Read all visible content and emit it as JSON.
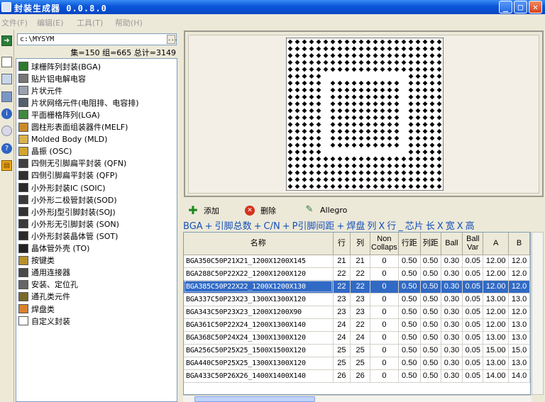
{
  "app": {
    "title": "封装生成器 0.0.8.0"
  },
  "window_buttons": {
    "minimize": "_",
    "maximize": "□",
    "close": "✕"
  },
  "menu": [
    {
      "label": "文件(F)"
    },
    {
      "label": "编辑(E)"
    },
    {
      "label": "工具(T)"
    },
    {
      "label": "帮助(H)"
    }
  ],
  "path": {
    "value": "c:\\MYSYM",
    "browse_label": "..."
  },
  "stats": "集=150 组=665 总计=3149",
  "tree": [
    {
      "label": "球栅阵列封装(BGA)",
      "icon": "bga-icon",
      "color": "#2f7a2f"
    },
    {
      "label": "贴片铝电解电容",
      "icon": "capacitor-icon",
      "color": "#777777"
    },
    {
      "label": "片状元件",
      "icon": "chip-component-icon",
      "color": "#9aa2b0"
    },
    {
      "label": "片状网络元件(电阻排、电容排)",
      "icon": "chip-network-icon",
      "color": "#55606e"
    },
    {
      "label": "平面栅格阵列(LGA)",
      "icon": "lga-icon",
      "color": "#3d8a3d"
    },
    {
      "label": "圆柱形表面组装器件(MELF)",
      "icon": "melf-icon",
      "color": "#c98a2a"
    },
    {
      "label": "Molded Body (MLD)",
      "icon": "molded-body-icon",
      "color": "#d9b24a"
    },
    {
      "label": "晶振 (OSC)",
      "icon": "oscillator-icon",
      "color": "#d2a52e"
    },
    {
      "label": "四侧无引脚扁平封装 (QFN)",
      "icon": "qfn-icon",
      "color": "#404040"
    },
    {
      "label": "四侧引脚扁平封装 (QFP)",
      "icon": "qfp-icon",
      "color": "#303030"
    },
    {
      "label": "小外形封装IC (SOIC)",
      "icon": "soic-icon",
      "color": "#2a2a2a"
    },
    {
      "label": "小外形二极管封装(SOD)",
      "icon": "sod-icon",
      "color": "#3a3a3a"
    },
    {
      "label": "小外形J型引脚封装(SOJ)",
      "icon": "soj-icon",
      "color": "#333333"
    },
    {
      "label": "小外形无引脚封装 (SON)",
      "icon": "son-icon",
      "color": "#3a3a3a"
    },
    {
      "label": "小外形封装晶体管 (SOT)",
      "icon": "sot-icon",
      "color": "#2b2b2b"
    },
    {
      "label": "晶体管外壳 (TO)",
      "icon": "to-icon",
      "color": "#222222"
    },
    {
      "label": "按键类",
      "icon": "button-icon",
      "color": "#b8902a"
    },
    {
      "label": "通用连接器",
      "icon": "connector-icon",
      "color": "#4a4a4a"
    },
    {
      "label": "安装、定位孔",
      "icon": "mounting-hole-icon",
      "color": "#666666"
    },
    {
      "label": "通孔类元件",
      "icon": "through-hole-icon",
      "color": "#7a6a2a"
    },
    {
      "label": "焊盘类",
      "icon": "pad-icon",
      "color": "#d9822b"
    },
    {
      "label": "自定义封装",
      "icon": "custom-package-icon",
      "color": "#ffffff"
    }
  ],
  "preview": {
    "rows": 22,
    "cols": 22,
    "inner_rows": 10,
    "inner_cols": 10,
    "hole_rows": 12,
    "hole_cols": 12
  },
  "toolbar": {
    "add_label": "添加",
    "delete_label": "删除",
    "allegro_label": "Allegro"
  },
  "formula": [
    "BGA",
    "+",
    "引脚总数",
    "+",
    "C/N",
    "+",
    "P引脚间距",
    "+",
    "焊盘",
    "列",
    "X",
    "行",
    "_",
    "芯片",
    "长",
    "X",
    "宽",
    "X",
    "高"
  ],
  "grid": {
    "columns": [
      "名称",
      "行",
      "列",
      "Non Collaps",
      "行距",
      "列距",
      "Ball",
      "Ball Var",
      "A",
      "B"
    ],
    "rows": [
      [
        "BGA350C50P21X21_1200X1200X145",
        "21",
        "21",
        "0",
        "0.50",
        "0.50",
        "0.30",
        "0.05",
        "12.00",
        "12.0"
      ],
      [
        "BGA288C50P22X22_1200X1200X120",
        "22",
        "22",
        "0",
        "0.50",
        "0.50",
        "0.30",
        "0.05",
        "12.00",
        "12.0"
      ],
      [
        "BGA385C50P22X22_1200X1200X130",
        "22",
        "22",
        "0",
        "0.50",
        "0.50",
        "0.30",
        "0.05",
        "12.00",
        "12.0"
      ],
      [
        "BGA337C50P23X23_1300X1300X120",
        "23",
        "23",
        "0",
        "0.50",
        "0.50",
        "0.30",
        "0.05",
        "13.00",
        "13.0"
      ],
      [
        "BGA343C50P23X23_1200X1200X90",
        "23",
        "23",
        "0",
        "0.50",
        "0.50",
        "0.30",
        "0.05",
        "12.00",
        "12.0"
      ],
      [
        "BGA361C50P22X24_1200X1300X140",
        "24",
        "22",
        "0",
        "0.50",
        "0.50",
        "0.30",
        "0.05",
        "12.00",
        "13.0"
      ],
      [
        "BGA368C50P24X24_1300X1300X120",
        "24",
        "24",
        "0",
        "0.50",
        "0.50",
        "0.30",
        "0.05",
        "13.00",
        "13.0"
      ],
      [
        "BGA256C50P25X25_1500X1500X120",
        "25",
        "25",
        "0",
        "0.50",
        "0.50",
        "0.30",
        "0.05",
        "15.00",
        "15.0"
      ],
      [
        "BGA440C50P25X25_1300X1300X120",
        "25",
        "25",
        "0",
        "0.50",
        "0.50",
        "0.30",
        "0.05",
        "13.00",
        "13.0"
      ],
      [
        "BGA433C50P26X26_1400X1400X140",
        "26",
        "26",
        "0",
        "0.50",
        "0.50",
        "0.30",
        "0.05",
        "14.00",
        "14.0"
      ]
    ],
    "selected_index": 2
  },
  "colors": {
    "title_bar": "#0a56d8",
    "selection": "#316ac5",
    "formula_text": "#1450b8"
  }
}
